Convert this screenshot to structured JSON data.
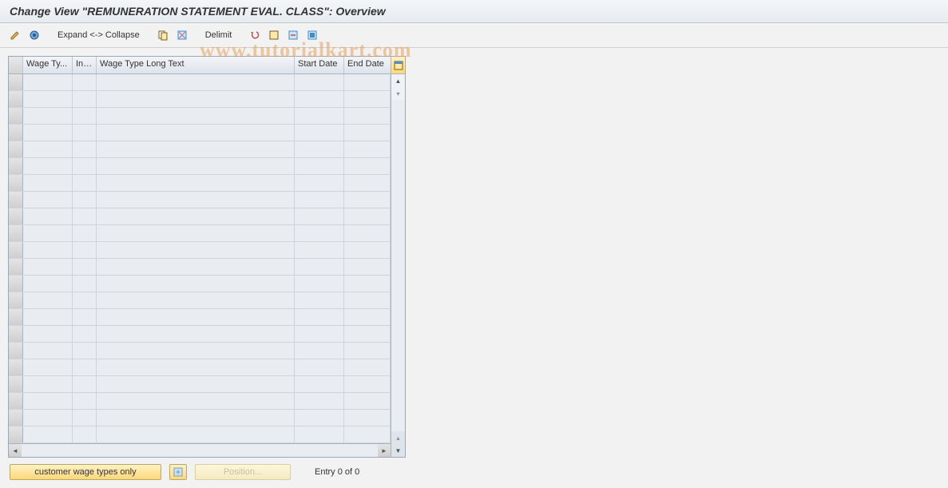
{
  "title": "Change View \"REMUNERATION STATEMENT EVAL. CLASS\": Overview",
  "toolbar": {
    "expand_label": "Expand <-> Collapse",
    "delimit_label": "Delimit"
  },
  "table": {
    "columns": {
      "wage_type": "Wage Ty...",
      "inf": "Inf...",
      "long_text": "Wage Type Long Text",
      "start_date": "Start Date",
      "end_date": "End Date"
    },
    "row_count": 22
  },
  "footer": {
    "customer_btn": "customer wage types only",
    "position_btn": "Position...",
    "entry_text": "Entry 0 of 0"
  },
  "watermark": "www.tutorialkart.com"
}
